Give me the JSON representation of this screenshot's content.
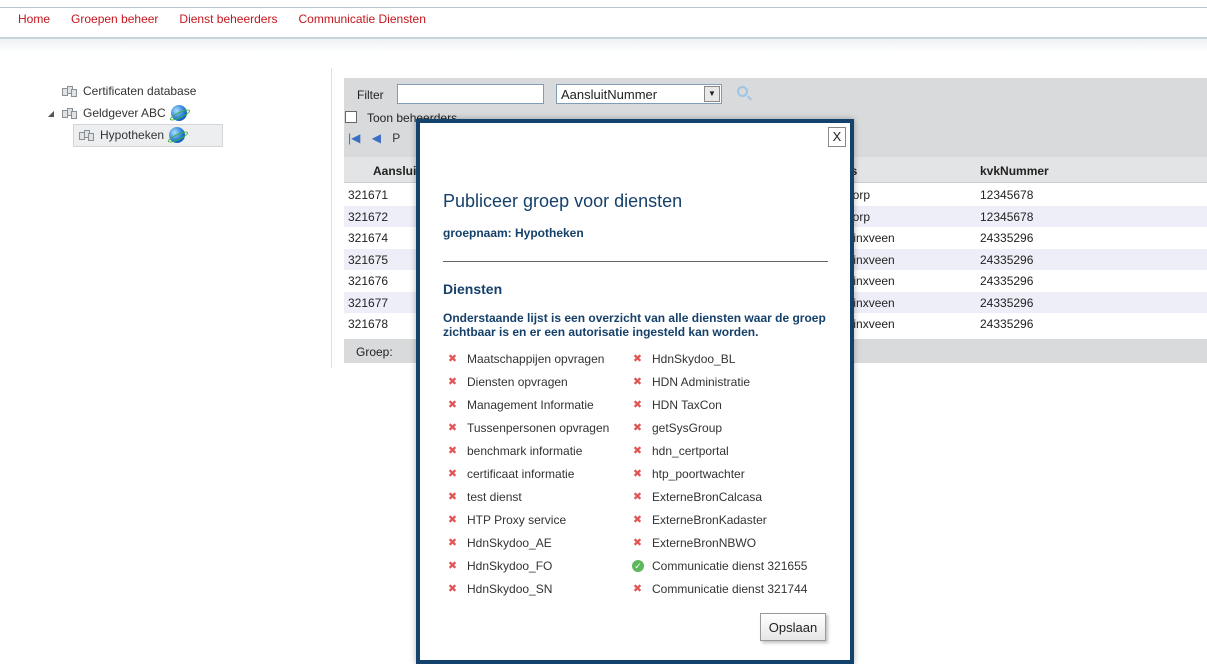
{
  "nav": {
    "items": [
      "Home",
      "Groepen beheer",
      "Dienst beheerders",
      "Communicatie Diensten"
    ]
  },
  "tree": {
    "items": [
      {
        "label": "Certificaten database"
      },
      {
        "label": "Geldgever ABC"
      },
      {
        "label": "Hypotheken"
      }
    ]
  },
  "toolbar": {
    "filter_label": "Filter",
    "filter_value": "",
    "select_value": "AansluitNummer",
    "checkbox_label": "Toon beheerders",
    "pager_first": "|◀",
    "pager_prev": "◀",
    "pager_text": "P"
  },
  "grid": {
    "headers": [
      "Aanslui",
      "ats",
      "kvkNummer"
    ],
    "rows": [
      [
        "321671",
        "kdorp",
        "12345678"
      ],
      [
        "321672",
        "kdorp",
        "12345678"
      ],
      [
        "321674",
        "ddinxveen",
        "24335296"
      ],
      [
        "321675",
        "ddinxveen",
        "24335296"
      ],
      [
        "321676",
        "ddinxveen",
        "24335296"
      ],
      [
        "321677",
        "ddinxveen",
        "24335296"
      ],
      [
        "321678",
        "ddinxveen",
        "24335296"
      ]
    ],
    "groep_label": "Groep:"
  },
  "modal": {
    "close_label": "X",
    "title": "Publiceer groep voor diensten",
    "groepnaam": "groepnaam: Hypotheken",
    "section": "Diensten",
    "description": "Onderstaande lijst is een overzicht van alle diensten waar de groep zichtbaar is en er een autorisatie ingesteld kan worden.",
    "services_left": [
      "Maatschappijen opvragen",
      "Diensten opvragen",
      "Management Informatie",
      "Tussenpersonen opvragen",
      "benchmark informatie",
      "certificaat informatie",
      "test dienst",
      "HTP Proxy service",
      "HdnSkydoo_AE",
      "HdnSkydoo_FO",
      "HdnSkydoo_SN"
    ],
    "services_right": [
      "HdnSkydoo_BL",
      "HDN Administratie",
      "HDN TaxCon",
      "getSysGroup",
      "hdn_certportal",
      "htp_poortwachter",
      "ExterneBronCalcasa",
      "ExterneBronKadaster",
      "ExterneBronNBWO",
      "Communicatie dienst 321655",
      "Communicatie dienst 321744"
    ],
    "enabled_service": "Communicatie dienst 321655",
    "save_label": "Opslaan"
  },
  "colors": {
    "nav_link": "#c4161c",
    "modal_border": "#13436c",
    "modal_text": "#15406a",
    "disabled_icon": "#e05656",
    "enabled_icon": "#5cb85c"
  }
}
